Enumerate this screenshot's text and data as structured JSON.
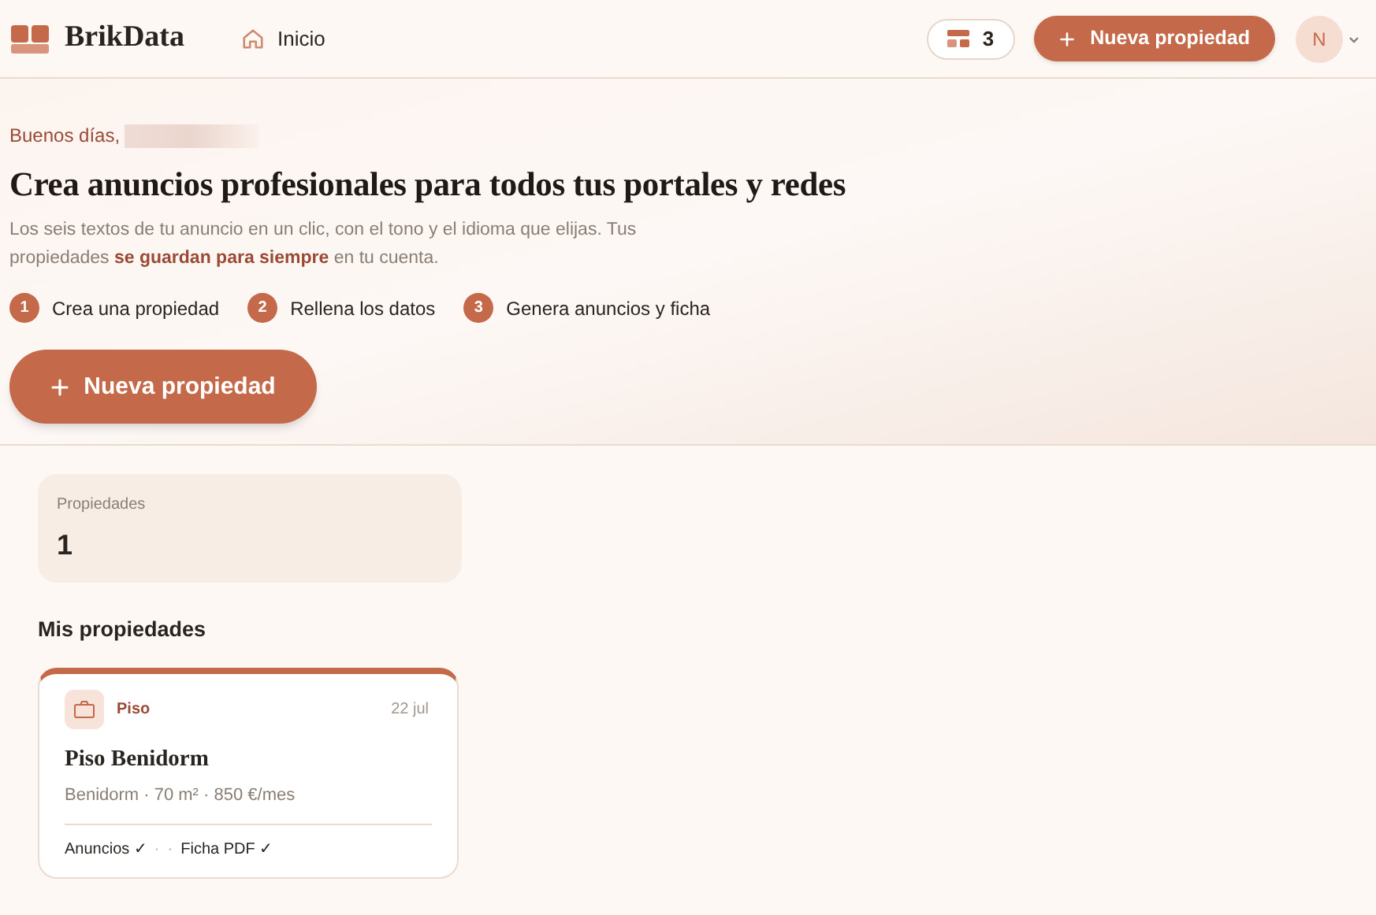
{
  "header": {
    "brand": "BrikData",
    "nav": [
      {
        "label": "Inicio",
        "selected": true
      }
    ],
    "credits": "3",
    "new_button": "Nueva propiedad",
    "avatar": "N"
  },
  "hero": {
    "greeting": "Buenos días,",
    "title": "Crea anuncios profesionales para todos tus portales y redes",
    "intro": "Los seis textos de tu anuncio en un clic, con el tono y el idioma que elijas. Tus propiedades **se guardan para siempre** en tu cuenta.",
    "steps": [
      {
        "number": "1",
        "label": "Crea una propiedad"
      },
      {
        "number": "2",
        "label": "Rellena los datos"
      },
      {
        "number": "3",
        "label": "Genera anuncios y ficha"
      }
    ],
    "cta": "Nueva propiedad"
  },
  "stats": [
    {
      "label": "Propiedades",
      "value": "1"
    }
  ],
  "section_title": "Mis propiedades",
  "properties": [
    {
      "type": "Piso",
      "date": "22 jul",
      "title": "Piso Benidorm",
      "details": "Benidorm · 70 m² · 850 €/mes",
      "footer": [
        "Anuncios ✓",
        "·",
        "·",
        "Ficha PDF ✓"
      ]
    }
  ]
}
